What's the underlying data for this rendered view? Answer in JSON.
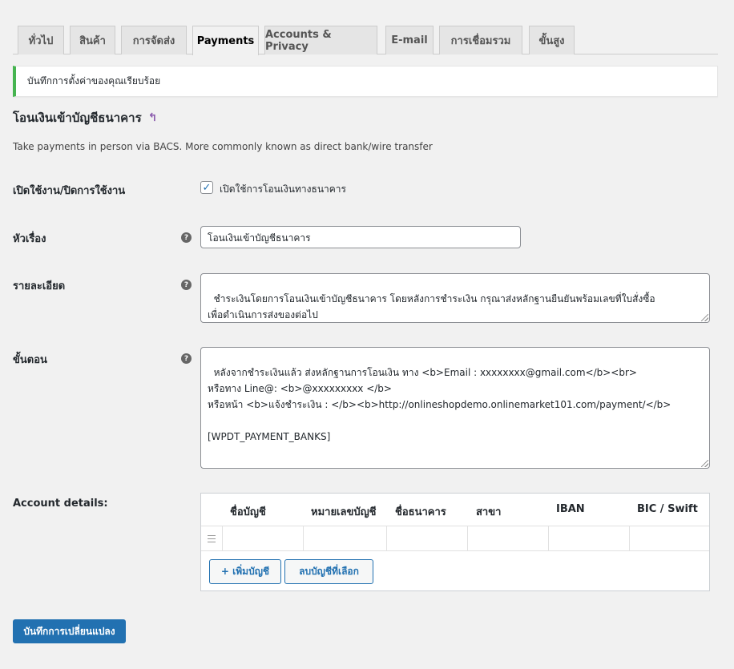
{
  "tabs": [
    "ทั่วไป",
    "สินค้า",
    "การจัดส่ง",
    "Payments",
    "Accounts & Privacy",
    "E-mail",
    "การเชื่อมรวม",
    "ขั้นสูง"
  ],
  "active_tab": "Payments",
  "notice": "บันทึกการตั้งค่าของคุณเรียบร้อย",
  "section": {
    "title": "โอนเงินเข้าบัญชีธนาคาร",
    "return_icon": "↰",
    "description": "Take payments in person via BACS. More commonly known as direct bank/wire transfer"
  },
  "fields": {
    "enable": {
      "label": "เปิดใช้งาน/ปิดการใช้งาน",
      "checkbox_label": "เปิดใช้การโอนเงินทางธนาคาร",
      "checked": true
    },
    "title": {
      "label": "หัวเรื่อง",
      "value": "โอนเงินเข้าบัญชีธนาคาร"
    },
    "details": {
      "label": "รายละเอียด",
      "value": "ชำระเงินโดยการโอนเงินเข้าบัญชีธนาคาร โดยหลังการชำระเงิน กรุณาส่งหลักฐานยืนยันพร้อมเลขที่ใบสั่งซื้อ\nเพื่อดำเนินการส่งของต่อไป"
    },
    "steps": {
      "label": "ขั้นตอน",
      "value": "หลังจากชำระเงินแล้ว ส่งหลักฐานการโอนเงิน ทาง <b>Email : xxxxxxxx@gmail.com</b><br>\nหรือทาง Line@: <b>@xxxxxxxxx </b>\nหรือหน้า <b>แจ้งชำระเงิน : </b><b>http://onlineshopdemo.onlinemarket101.com/payment/</b>\n\n[WPDT_PAYMENT_BANKS]"
    }
  },
  "account_details": {
    "label": "Account details:",
    "columns": [
      "ชื่อบัญชี",
      "หมายเลขบัญชี",
      "ชื่อธนาคาร",
      "สาขา",
      "IBAN",
      "BIC / Swift"
    ],
    "add_button": "+ เพิ่มบัญชี",
    "remove_button": "ลบบัญชีที่เลือก"
  },
  "save_button": "บันทึกการเปลี่ยนแปลง",
  "help_icon": "?",
  "check_mark": "✓",
  "colors": {
    "primary": "#2271b1",
    "success": "#46b450",
    "return_icon": "#8a5aad"
  }
}
